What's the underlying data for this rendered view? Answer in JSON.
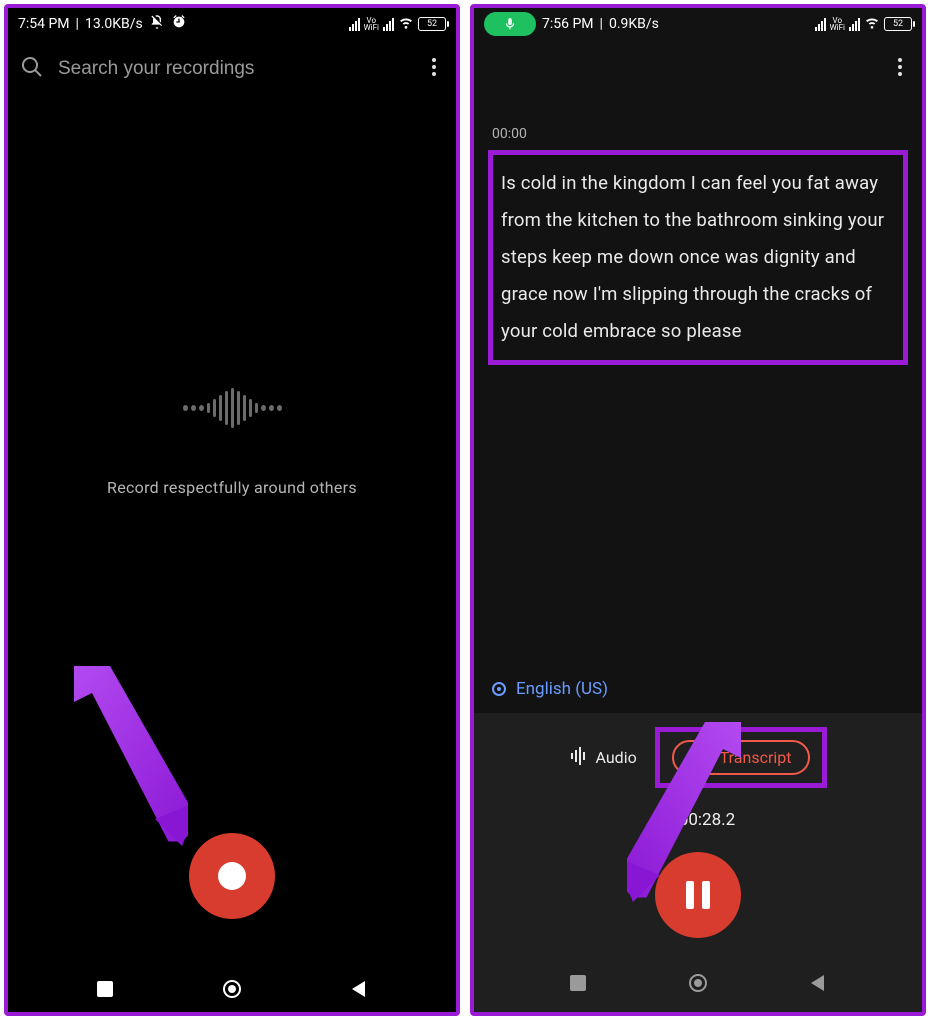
{
  "left": {
    "status": {
      "time": "7:54 PM",
      "net": "13.0KB/s",
      "battery": "52"
    },
    "search": {
      "placeholder": "Search your recordings"
    },
    "hint": "Record respectfully around others"
  },
  "right": {
    "status": {
      "time": "7:56 PM",
      "net": "0.9KB/s",
      "battery": "52"
    },
    "transcript_start": "00:00",
    "transcript_text": "Is cold in the kingdom I can feel you fat away from the kitchen to the bathroom sinking your steps keep me down once was dignity and grace now I'm slipping through the cracks of your cold embrace so please",
    "language": "English (US)",
    "tabs": {
      "audio": "Audio",
      "transcript": "Transcript"
    },
    "elapsed": "00:28.2"
  }
}
